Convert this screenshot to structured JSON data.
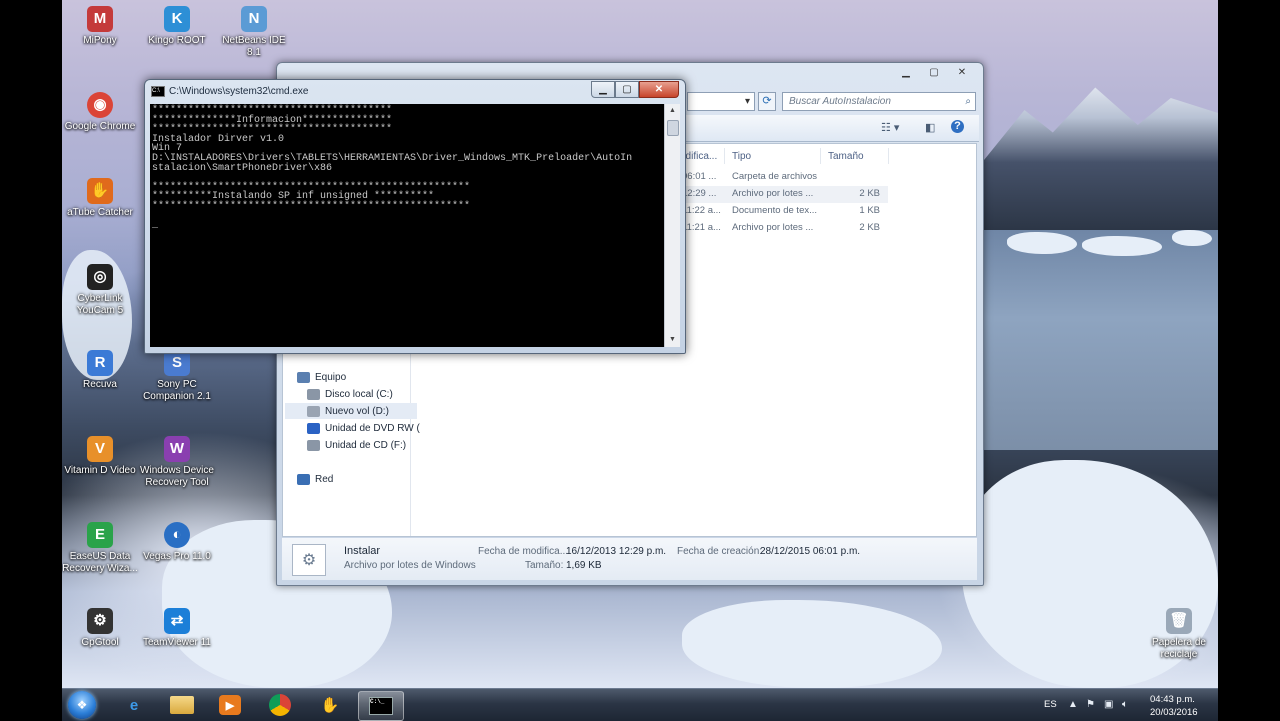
{
  "desktop": {
    "icons": [
      {
        "id": "mipony",
        "label": "MiPony",
        "glyph": "M",
        "color": "#c43a3a"
      },
      {
        "id": "kingo",
        "label": "Kingo ROOT",
        "glyph": "K",
        "color": "#2d8fd6"
      },
      {
        "id": "netbeans",
        "label": "NetBeans IDE 8.1",
        "glyph": "N",
        "color": "#5b9bd5"
      },
      {
        "id": "chrome",
        "label": "Google Chrome",
        "glyph": "◉",
        "color": "#db4437"
      },
      {
        "id": "atube",
        "label": "aTube Catcher",
        "glyph": "✋",
        "color": "#e06a1c"
      },
      {
        "id": "cyberlink",
        "label": "CyberLink YouCam 5",
        "glyph": "◎",
        "color": "#222222"
      },
      {
        "id": "recuva",
        "label": "Recuva",
        "glyph": "R",
        "color": "#3b7ad6"
      },
      {
        "id": "sony",
        "label": "Sony PC Companion 2.1",
        "glyph": "S",
        "color": "#4a7bd0"
      },
      {
        "id": "vitamin",
        "label": "Vitamin D Video",
        "glyph": "V",
        "color": "#e8902a"
      },
      {
        "id": "wdrt",
        "label": "Windows Device Recovery Tool",
        "glyph": "W",
        "color": "#8a3fb0"
      },
      {
        "id": "easeus",
        "label": "EaseUS Data Recovery Wiza...",
        "glyph": "E",
        "color": "#2aa34a"
      },
      {
        "id": "vegas",
        "label": "Vegas Pro 11.0",
        "glyph": "◐",
        "color": "#2a6fc4"
      },
      {
        "id": "gpgtool",
        "label": "GpGtool",
        "glyph": "⚙",
        "color": "#333333"
      },
      {
        "id": "teamviewer",
        "label": "TeamViewer 11",
        "glyph": "⇄",
        "color": "#1c7fd8"
      },
      {
        "id": "recycle",
        "label": "Papelera de reciclaje",
        "glyph": "🗑",
        "color": "#9aa8b8"
      }
    ]
  },
  "explorer": {
    "address_tail": "▾",
    "search_placeholder": "Buscar AutoInstalacion",
    "columns": {
      "date": "odifica...",
      "type": "Tipo",
      "size": "Tamaño"
    },
    "rows": [
      {
        "date": "06:01 ...",
        "type": "Carpeta de archivos",
        "size": ""
      },
      {
        "date": "12:29 ...",
        "type": "Archivo por lotes ...",
        "size": "2 KB"
      },
      {
        "date": "11:22 a...",
        "type": "Documento de tex...",
        "size": "1 KB"
      },
      {
        "date": "11:21 a...",
        "type": "Archivo por lotes ...",
        "size": "2 KB"
      }
    ],
    "nav": [
      {
        "label": "Equipo",
        "color": "#5a7fb0"
      },
      {
        "label": "Disco local (C:)",
        "color": "#8a96a6"
      },
      {
        "label": "Nuevo vol (D:)",
        "color": "#9aa4b2"
      },
      {
        "label": "Unidad de DVD RW (",
        "color": "#2a62c4"
      },
      {
        "label": "Unidad de CD (F:)",
        "color": "#8a96a6"
      },
      {
        "label": "Red",
        "color": "#3a6fb4"
      }
    ],
    "details": {
      "name": "Instalar",
      "type": "Archivo por lotes de Windows",
      "mod_label": "Fecha de modifica...",
      "mod_value": "16/12/2013 12:29 p.m.",
      "created_label": "Fecha de creación:",
      "created_value": "28/12/2015 06:01 p.m.",
      "size_label": "Tamaño:",
      "size_value": "1,69 KB"
    }
  },
  "cmd": {
    "title": "C:\\Windows\\system32\\cmd.exe",
    "lines": [
      "****************************************",
      "**************Informacion***************",
      "****************************************",
      "Instalador Dirver v1.0",
      "Win 7",
      "D:\\INSTALADORES\\Drivers\\TABLETS\\HERRAMIENTAS\\Driver_Windows_MTK_Preloader\\AutoIn",
      "stalacion\\SmartPhoneDriver\\x86",
      "",
      "*****************************************************",
      "**********Instalando SP inf unsigned **********",
      "*****************************************************",
      "",
      "_"
    ]
  },
  "taskbar": {
    "lang": "ES",
    "time": "04:43 p.m.",
    "date": "20/03/2016"
  }
}
